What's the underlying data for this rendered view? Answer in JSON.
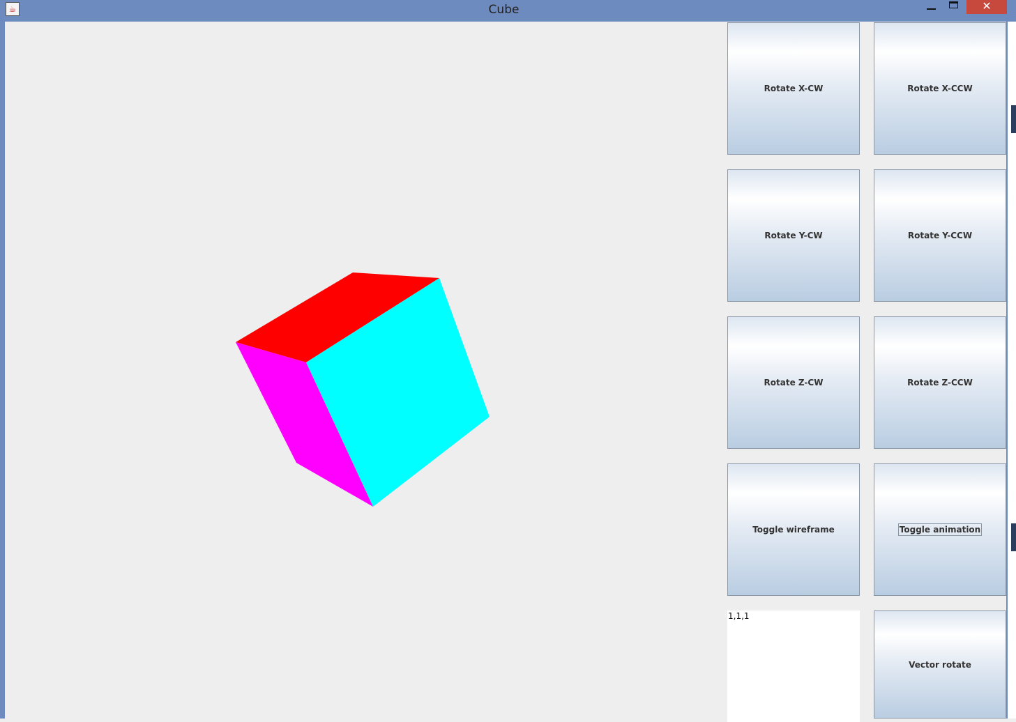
{
  "window": {
    "title": "Cube",
    "close_glyph": "✕",
    "app_icon": "java-cup-icon"
  },
  "cube": {
    "top_face_color": "#ff0000",
    "left_face_color": "#ff00ff",
    "front_face_color": "#00ffff"
  },
  "buttons": {
    "rotate_x_cw": "Rotate X-CW",
    "rotate_x_ccw": "Rotate X-CCW",
    "rotate_y_cw": "Rotate Y-CW",
    "rotate_y_ccw": "Rotate Y-CCW",
    "rotate_z_cw": "Rotate Z-CW",
    "rotate_z_ccw": "Rotate Z-CCW",
    "toggle_wireframe": "Toggle wireframe",
    "toggle_animation": "Toggle animation",
    "vector_rotate": "Vector rotate"
  },
  "vector_input": {
    "value": "1,1,1"
  },
  "colors": {
    "titlebar": "#6d8bbf",
    "close_button": "#c7483d",
    "canvas_background": "#eeeeee"
  }
}
